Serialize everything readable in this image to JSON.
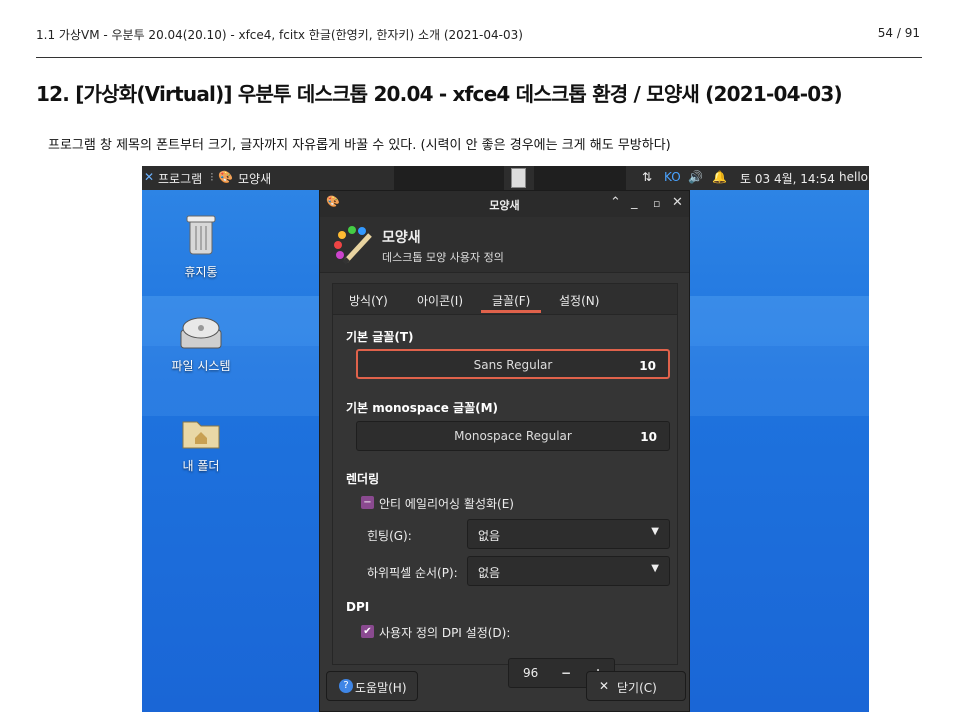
{
  "header": {
    "doc_title": "1.1 가상VM - 우분투 20.04(20.10) - xfce4, fcitx 한글(한영키, 한자키) 소개 (2021-04-03)",
    "page_number": "54 / 91"
  },
  "slide_title": "12. [가상화(Virtual)] 우분투 데스크톱 20.04 - xfce4 데스크톱 환경 / 모양새 (2021-04-03)",
  "caption": "프로그램 창 제목의 폰트부터 크기, 글자까지 자유롭게 바꿀 수 있다. (시력이 안 좋은 경우에는 크게 해도 무방하다)",
  "panel": {
    "apps_menu": "프로그램",
    "task": "모양새",
    "kbd": "KO",
    "clock": "토 03  4월, 14:54",
    "user": "hello"
  },
  "desktop_icons": [
    "휴지통",
    "파일 시스템",
    "내 폴더"
  ],
  "dialog": {
    "title": "모양새",
    "header_title": "모양새",
    "header_subtitle": "데스크톱 모양 사용자 정의",
    "tabs": [
      "방식(Y)",
      "아이콘(I)",
      "글꼴(F)",
      "설정(N)"
    ],
    "active_tab": 2,
    "default_font": {
      "label": "기본 글꼴(T)",
      "name": "Sans Regular",
      "size": "10"
    },
    "mono_font": {
      "label": "기본 monospace 글꼴(M)",
      "name": "Monospace Regular",
      "size": "10"
    },
    "rendering": {
      "label": "렌더링",
      "antialias": "안티 에일리어싱 활성화(E)",
      "hinting_label": "힌팅(G):",
      "hinting_value": "없음",
      "subpixel_label": "하위픽셀 순서(P):",
      "subpixel_value": "없음"
    },
    "dpi": {
      "label": "DPI",
      "custom": "사용자 정의 DPI 설정(D):",
      "value": "96",
      "minus": "−",
      "plus": "+"
    },
    "help_button": "도움말(H)",
    "close_button": "닫기(C)"
  },
  "colors": {
    "accent": "#e0624b",
    "desktop": "#1e73de",
    "checkbox": "#8a4a90"
  }
}
